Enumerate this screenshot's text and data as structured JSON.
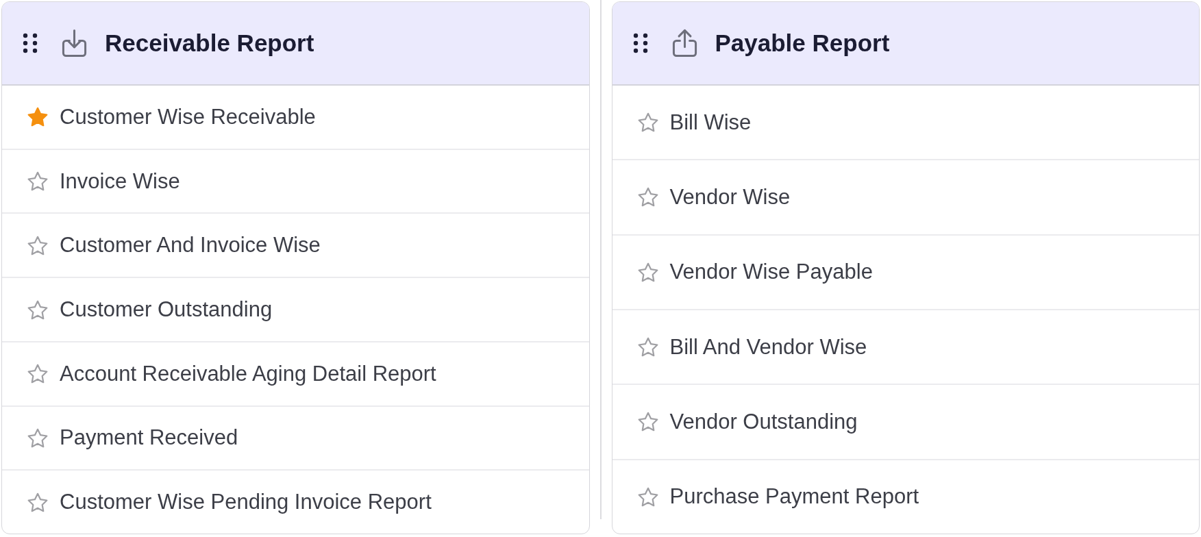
{
  "panels": [
    {
      "title": "Receivable Report",
      "kind": "incoming",
      "items": [
        {
          "label": "Customer Wise Receivable",
          "favorite": true
        },
        {
          "label": "Invoice Wise",
          "favorite": false
        },
        {
          "label": "Customer And Invoice Wise",
          "favorite": false
        },
        {
          "label": "Customer Outstanding",
          "favorite": false
        },
        {
          "label": "Account Receivable Aging Detail Report",
          "favorite": false
        },
        {
          "label": "Payment Received",
          "favorite": false
        },
        {
          "label": "Customer Wise Pending Invoice Report",
          "favorite": false
        }
      ]
    },
    {
      "title": "Payable Report",
      "kind": "outgoing",
      "items": [
        {
          "label": "Bill Wise",
          "favorite": false
        },
        {
          "label": "Vendor Wise",
          "favorite": false
        },
        {
          "label": "Vendor Wise Payable",
          "favorite": false
        },
        {
          "label": "Bill And Vendor Wise",
          "favorite": false
        },
        {
          "label": "Vendor Outstanding",
          "favorite": false
        },
        {
          "label": "Purchase Payment Report",
          "favorite": false
        }
      ]
    }
  ]
}
